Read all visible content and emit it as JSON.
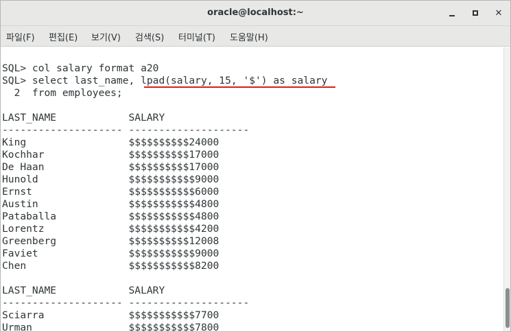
{
  "window": {
    "title": "oracle@localhost:~",
    "minimize_glyph": "",
    "maximize_glyph": "",
    "close_glyph": "✕"
  },
  "menu": [
    {
      "label": "파일(F)"
    },
    {
      "label": "편집(E)"
    },
    {
      "label": "보기(V)"
    },
    {
      "label": "검색(S)"
    },
    {
      "label": "터미널(T)"
    },
    {
      "label": "도움말(H)"
    }
  ],
  "terminal": {
    "lines": [
      "",
      "SQL> col salary format a20",
      "SQL> select last_name, lpad(salary, 15, '$') as salary",
      "  2  from employees;",
      "",
      "LAST_NAME            SALARY",
      "-------------------- --------------------",
      "King                 $$$$$$$$$$24000",
      "Kochhar              $$$$$$$$$$17000",
      "De Haan              $$$$$$$$$$17000",
      "Hunold               $$$$$$$$$$$9000",
      "Ernst                $$$$$$$$$$$6000",
      "Austin               $$$$$$$$$$$4800",
      "Pataballa            $$$$$$$$$$$4800",
      "Lorentz              $$$$$$$$$$$4200",
      "Greenberg            $$$$$$$$$$12008",
      "Faviet               $$$$$$$$$$$9000",
      "Chen                 $$$$$$$$$$$8200",
      "",
      "LAST_NAME            SALARY",
      "-------------------- --------------------",
      "Sciarra              $$$$$$$$$$$7700",
      "Urman                $$$$$$$$$$$7800"
    ]
  },
  "colors": {
    "annotation_underline": "#d42020",
    "terminal_text": "#2e3436",
    "chrome_background": "#e8e8e7"
  }
}
